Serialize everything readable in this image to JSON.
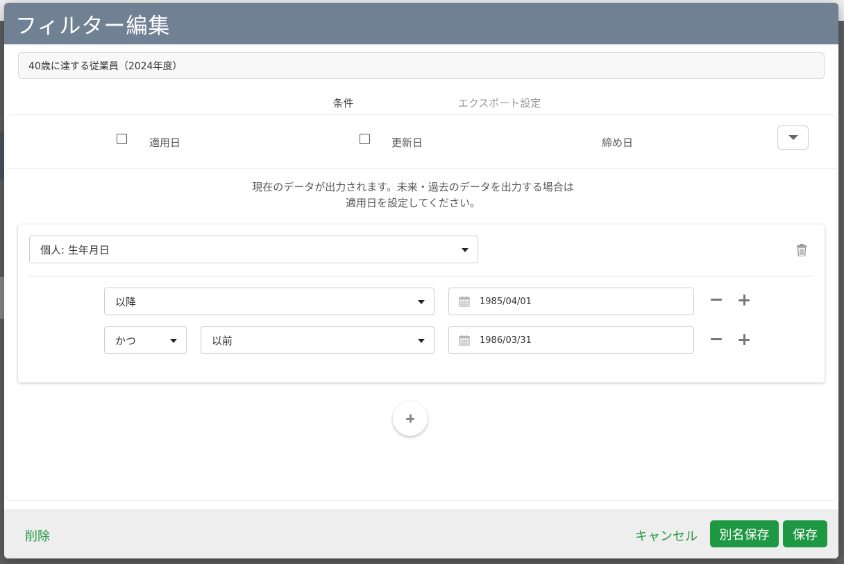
{
  "dialog": {
    "title": "フィルター編集"
  },
  "filter_name": {
    "value": "40歳に達する従業員（2024年度）"
  },
  "tabs": [
    {
      "label": "条件",
      "active": true
    },
    {
      "label": "エクスポート設定",
      "active": false
    }
  ],
  "date_options": {
    "apply_date": {
      "label": "適用日",
      "checked": false
    },
    "update_date": {
      "label": "更新日",
      "checked": false
    },
    "closing_date": {
      "label": "締め日"
    },
    "toggle_icon": "caret-down-icon"
  },
  "info_message": {
    "line1": "現在のデータが出力されます。未来・過去のデータを出力する場合は",
    "line2": "適用日を設定してください。"
  },
  "condition": {
    "field": "個人: 生年月日",
    "delete_icon": "trash-icon",
    "rows": [
      {
        "connector": "",
        "operator": "以降",
        "date": "1985/04/01"
      },
      {
        "connector": "かつ",
        "operator": "以前",
        "date": "1986/03/31"
      }
    ]
  },
  "add_condition_icon": "plus-icon",
  "footer": {
    "delete_label": "削除",
    "cancel_label": "キャンセル",
    "save_as_label": "別名保存",
    "save_label": "保存"
  },
  "colors": {
    "header": "#718194",
    "accent_green": "#1f9843"
  }
}
